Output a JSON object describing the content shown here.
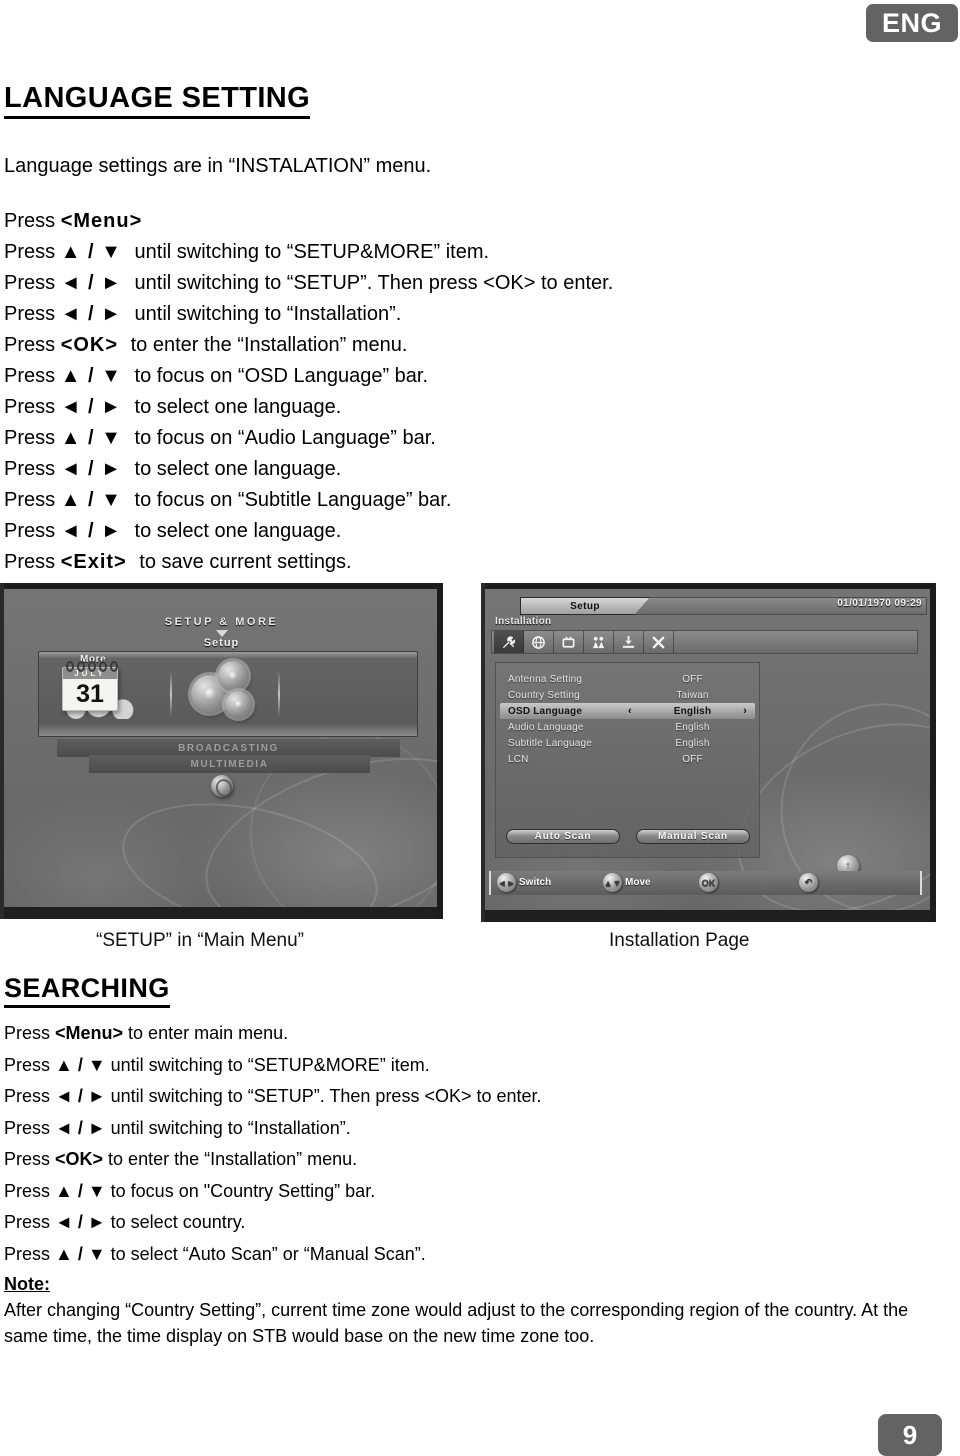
{
  "header": {
    "language_badge": "ENG"
  },
  "footer": {
    "page_number": "9"
  },
  "language_section": {
    "title": "LANGUAGE SETTING",
    "intro": "Language settings are in “INSTALATION” menu.",
    "steps": [
      {
        "prefix": "Press ",
        "key": "<Menu>",
        "rest": ""
      },
      {
        "prefix": "Press ",
        "key": "▲ / ▼",
        "rest": " until switching to “SETUP&MORE” item."
      },
      {
        "prefix": "Press ",
        "key": "◄ / ►",
        "rest": " until switching to “SETUP”. Then press <OK> to enter."
      },
      {
        "prefix": "Press ",
        "key": "◄ / ►",
        "rest": " until switching to “Installation”."
      },
      {
        "prefix": "Press ",
        "key": "<OK>",
        "rest": " to enter the “Installation” menu."
      },
      {
        "prefix": "Press ",
        "key": "▲ / ▼",
        "rest": " to focus on “OSD Language” bar."
      },
      {
        "prefix": "Press ",
        "key": "◄ / ►",
        "rest": " to select one language."
      },
      {
        "prefix": "Press ",
        "key": "▲ / ▼",
        "rest": " to focus on “Audio Language” bar."
      },
      {
        "prefix": "Press ",
        "key": "◄ / ►",
        "rest": " to select one language."
      },
      {
        "prefix": "Press ",
        "key": "▲ / ▼",
        "rest": " to focus on “Subtitle Language” bar."
      },
      {
        "prefix": "Press ",
        "key": "◄ / ►",
        "rest": " to select one language."
      },
      {
        "prefix": "Press ",
        "key": "<Exit>",
        "rest": " to save current settings."
      }
    ]
  },
  "figures": {
    "left_caption": "“SETUP” in “Main Menu”",
    "right_caption": "Installation Page",
    "main_menu": {
      "heading": "SETUP & MORE",
      "subheading": "Setup",
      "more_label": "More",
      "calendar_month": "JULY",
      "calendar_day": "31",
      "bar_broadcasting": "BROADCASTING",
      "bar_multimedia": "MULTIMEDIA"
    },
    "installation": {
      "tab_label": "Setup",
      "datetime": "01/01/1970 09:29",
      "breadcrumb": "Installation",
      "icons": [
        "tools-icon",
        "antenna-icon",
        "tv-icon",
        "users-icon",
        "install-icon",
        "close-icon"
      ],
      "rows": [
        {
          "label": "Antenna Setting",
          "value": "OFF",
          "selected": false
        },
        {
          "label": "Country Setting",
          "value": "Taiwan",
          "selected": false
        },
        {
          "label": "OSD Language",
          "value": "English",
          "selected": true
        },
        {
          "label": "Audio Language",
          "value": "English",
          "selected": false
        },
        {
          "label": "Subtitle Language",
          "value": "English",
          "selected": false
        },
        {
          "label": "LCN",
          "value": "OFF",
          "selected": false
        }
      ],
      "buttons": {
        "auto_scan": "Auto Scan",
        "manual_scan": "Manual Scan"
      },
      "help_bar": [
        {
          "glyph": "◄►",
          "label": "Switch"
        },
        {
          "glyph": "▲▼",
          "label": "Move"
        },
        {
          "glyph": "OK",
          "label": ""
        },
        {
          "glyph": "↶",
          "label": ""
        }
      ],
      "return_glyph": "↑"
    }
  },
  "searching_section": {
    "title": "SEARCHING",
    "steps": [
      {
        "prefix": "Press ",
        "key": "<Menu>",
        "rest": " to enter main menu."
      },
      {
        "prefix": "Press ",
        "key": "▲ / ▼",
        "rest": " until switching to “SETUP&MORE” item."
      },
      {
        "prefix": "Press ",
        "key": "◄ / ►",
        "rest": " until switching to “SETUP”. Then press <OK> to enter."
      },
      {
        "prefix": "Press ",
        "key": "◄ / ►",
        "rest": " until switching to “Installation”."
      },
      {
        "prefix": "Press ",
        "key": "<OK>",
        "rest": " to enter the “Installation” menu."
      },
      {
        "prefix": "Press ",
        "key": "▲ / ▼",
        "rest": " to focus on \"Country Setting” bar."
      },
      {
        "prefix": "Press ",
        "key": "◄ / ►",
        "rest": " to select country."
      },
      {
        "prefix": "Press ",
        "key": "▲ / ▼",
        "rest": " to select “Auto Scan” or “Manual Scan”."
      }
    ],
    "note_label": "Note:",
    "note_body": "After changing “Country Setting”, current time zone would adjust to the corresponding region of the country. At the same time, the time display on STB would base on the new time zone too."
  },
  "colors": {
    "badge_gray": "#636363",
    "screen_gray": "#6f6f6f"
  }
}
